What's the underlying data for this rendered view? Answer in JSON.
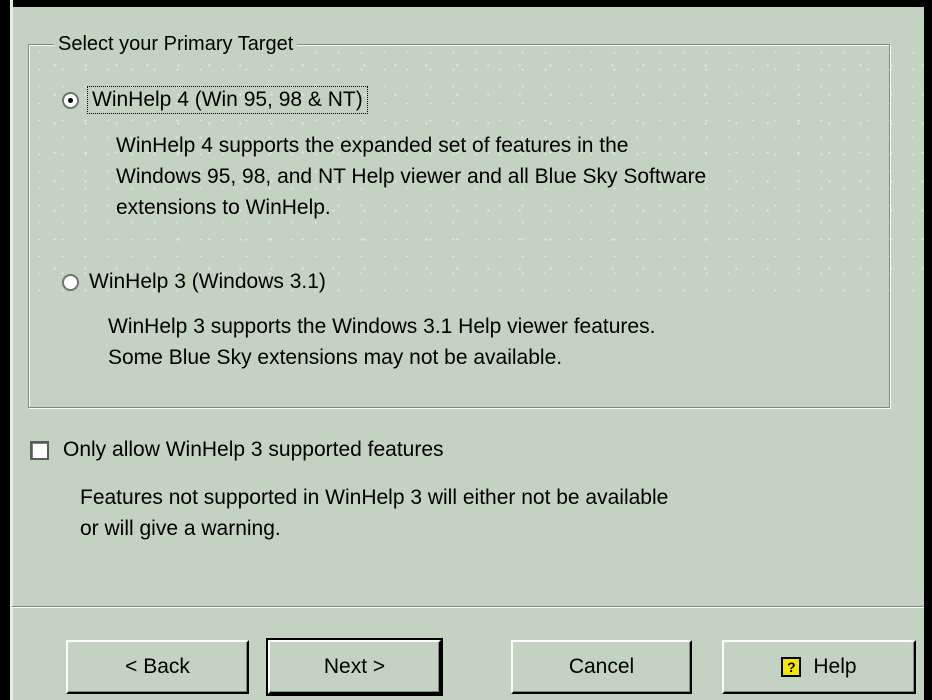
{
  "group": {
    "title": "Select your Primary Target"
  },
  "targets": [
    {
      "label": "WinHelp 4 (Win 95, 98 & NT)",
      "description_lines": [
        "WinHelp 4 supports the expanded set of features in the",
        "Windows 95, 98, and NT Help viewer and all Blue Sky Software",
        "extensions to WinHelp."
      ],
      "selected": true
    },
    {
      "label": "WinHelp 3 (Windows 3.1)",
      "description_lines": [
        "WinHelp 3 supports the Windows 3.1 Help viewer features.",
        "Some Blue Sky extensions may not be available."
      ],
      "selected": false
    }
  ],
  "restrict": {
    "label": "Only allow WinHelp 3 supported features",
    "checked": false,
    "description_lines": [
      "Features not supported in WinHelp 3 will either not be available",
      "or will give a warning."
    ]
  },
  "buttons": {
    "back": "< Back",
    "next": "Next >",
    "cancel": "Cancel",
    "help": "Help",
    "help_icon": "question-book-icon"
  },
  "colors": {
    "dialog_background": "#c4d2c2",
    "help_icon_yellow": "#f5e600"
  }
}
